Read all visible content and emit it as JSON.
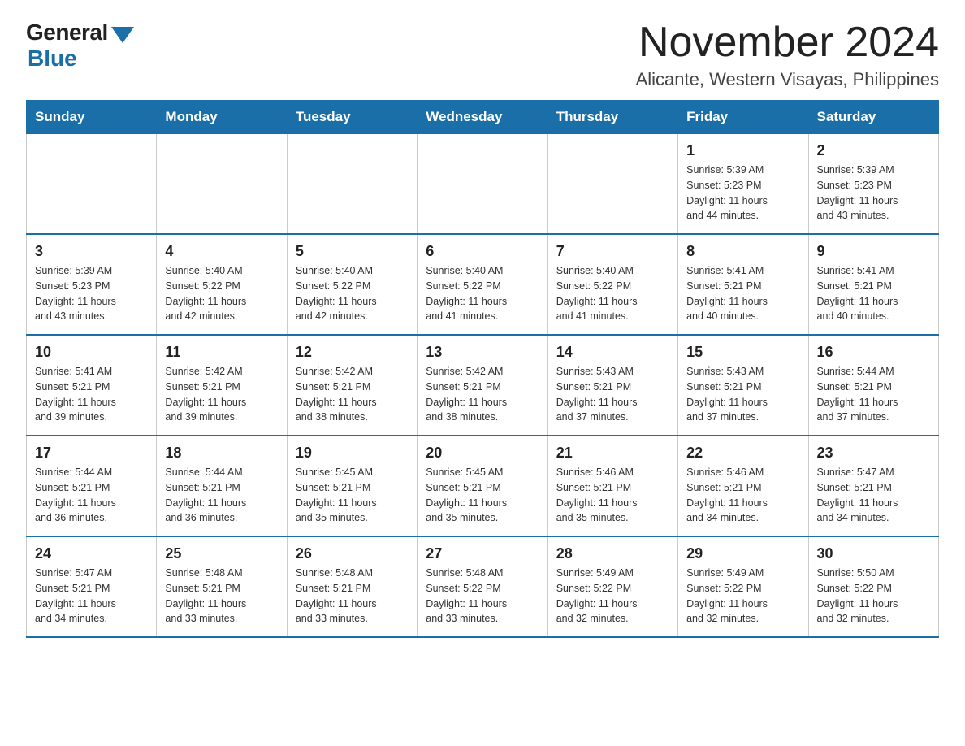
{
  "logo": {
    "general": "General",
    "blue": "Blue"
  },
  "header": {
    "month_year": "November 2024",
    "location": "Alicante, Western Visayas, Philippines"
  },
  "weekdays": [
    "Sunday",
    "Monday",
    "Tuesday",
    "Wednesday",
    "Thursday",
    "Friday",
    "Saturday"
  ],
  "weeks": [
    [
      {
        "day": "",
        "info": ""
      },
      {
        "day": "",
        "info": ""
      },
      {
        "day": "",
        "info": ""
      },
      {
        "day": "",
        "info": ""
      },
      {
        "day": "",
        "info": ""
      },
      {
        "day": "1",
        "info": "Sunrise: 5:39 AM\nSunset: 5:23 PM\nDaylight: 11 hours\nand 44 minutes."
      },
      {
        "day": "2",
        "info": "Sunrise: 5:39 AM\nSunset: 5:23 PM\nDaylight: 11 hours\nand 43 minutes."
      }
    ],
    [
      {
        "day": "3",
        "info": "Sunrise: 5:39 AM\nSunset: 5:23 PM\nDaylight: 11 hours\nand 43 minutes."
      },
      {
        "day": "4",
        "info": "Sunrise: 5:40 AM\nSunset: 5:22 PM\nDaylight: 11 hours\nand 42 minutes."
      },
      {
        "day": "5",
        "info": "Sunrise: 5:40 AM\nSunset: 5:22 PM\nDaylight: 11 hours\nand 42 minutes."
      },
      {
        "day": "6",
        "info": "Sunrise: 5:40 AM\nSunset: 5:22 PM\nDaylight: 11 hours\nand 41 minutes."
      },
      {
        "day": "7",
        "info": "Sunrise: 5:40 AM\nSunset: 5:22 PM\nDaylight: 11 hours\nand 41 minutes."
      },
      {
        "day": "8",
        "info": "Sunrise: 5:41 AM\nSunset: 5:21 PM\nDaylight: 11 hours\nand 40 minutes."
      },
      {
        "day": "9",
        "info": "Sunrise: 5:41 AM\nSunset: 5:21 PM\nDaylight: 11 hours\nand 40 minutes."
      }
    ],
    [
      {
        "day": "10",
        "info": "Sunrise: 5:41 AM\nSunset: 5:21 PM\nDaylight: 11 hours\nand 39 minutes."
      },
      {
        "day": "11",
        "info": "Sunrise: 5:42 AM\nSunset: 5:21 PM\nDaylight: 11 hours\nand 39 minutes."
      },
      {
        "day": "12",
        "info": "Sunrise: 5:42 AM\nSunset: 5:21 PM\nDaylight: 11 hours\nand 38 minutes."
      },
      {
        "day": "13",
        "info": "Sunrise: 5:42 AM\nSunset: 5:21 PM\nDaylight: 11 hours\nand 38 minutes."
      },
      {
        "day": "14",
        "info": "Sunrise: 5:43 AM\nSunset: 5:21 PM\nDaylight: 11 hours\nand 37 minutes."
      },
      {
        "day": "15",
        "info": "Sunrise: 5:43 AM\nSunset: 5:21 PM\nDaylight: 11 hours\nand 37 minutes."
      },
      {
        "day": "16",
        "info": "Sunrise: 5:44 AM\nSunset: 5:21 PM\nDaylight: 11 hours\nand 37 minutes."
      }
    ],
    [
      {
        "day": "17",
        "info": "Sunrise: 5:44 AM\nSunset: 5:21 PM\nDaylight: 11 hours\nand 36 minutes."
      },
      {
        "day": "18",
        "info": "Sunrise: 5:44 AM\nSunset: 5:21 PM\nDaylight: 11 hours\nand 36 minutes."
      },
      {
        "day": "19",
        "info": "Sunrise: 5:45 AM\nSunset: 5:21 PM\nDaylight: 11 hours\nand 35 minutes."
      },
      {
        "day": "20",
        "info": "Sunrise: 5:45 AM\nSunset: 5:21 PM\nDaylight: 11 hours\nand 35 minutes."
      },
      {
        "day": "21",
        "info": "Sunrise: 5:46 AM\nSunset: 5:21 PM\nDaylight: 11 hours\nand 35 minutes."
      },
      {
        "day": "22",
        "info": "Sunrise: 5:46 AM\nSunset: 5:21 PM\nDaylight: 11 hours\nand 34 minutes."
      },
      {
        "day": "23",
        "info": "Sunrise: 5:47 AM\nSunset: 5:21 PM\nDaylight: 11 hours\nand 34 minutes."
      }
    ],
    [
      {
        "day": "24",
        "info": "Sunrise: 5:47 AM\nSunset: 5:21 PM\nDaylight: 11 hours\nand 34 minutes."
      },
      {
        "day": "25",
        "info": "Sunrise: 5:48 AM\nSunset: 5:21 PM\nDaylight: 11 hours\nand 33 minutes."
      },
      {
        "day": "26",
        "info": "Sunrise: 5:48 AM\nSunset: 5:21 PM\nDaylight: 11 hours\nand 33 minutes."
      },
      {
        "day": "27",
        "info": "Sunrise: 5:48 AM\nSunset: 5:22 PM\nDaylight: 11 hours\nand 33 minutes."
      },
      {
        "day": "28",
        "info": "Sunrise: 5:49 AM\nSunset: 5:22 PM\nDaylight: 11 hours\nand 32 minutes."
      },
      {
        "day": "29",
        "info": "Sunrise: 5:49 AM\nSunset: 5:22 PM\nDaylight: 11 hours\nand 32 minutes."
      },
      {
        "day": "30",
        "info": "Sunrise: 5:50 AM\nSunset: 5:22 PM\nDaylight: 11 hours\nand 32 minutes."
      }
    ]
  ]
}
